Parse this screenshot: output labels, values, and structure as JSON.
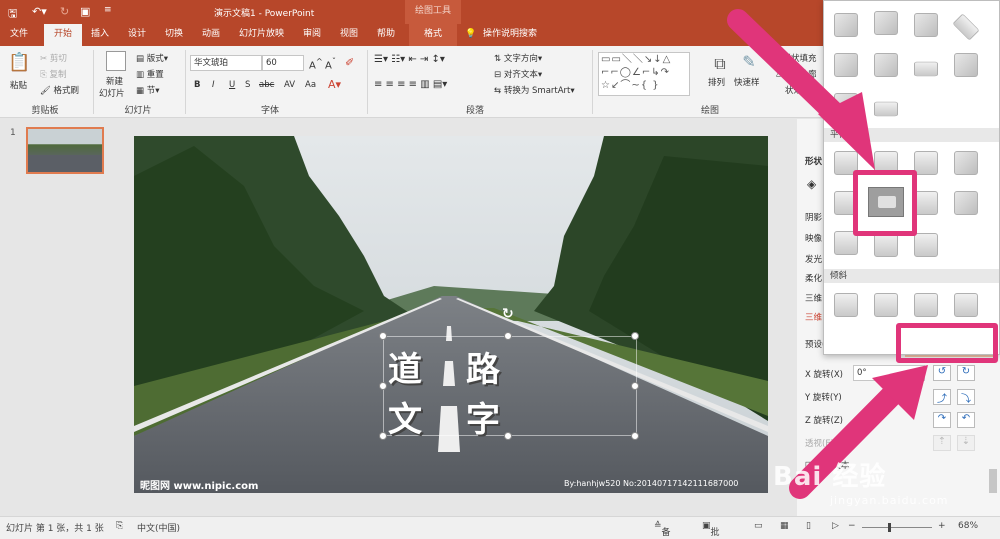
{
  "title_bar": {
    "document_title": "演示文稿1 - PowerPoint",
    "context_tab_group": "绘图工具"
  },
  "tabs": [
    "文件",
    "开始",
    "插入",
    "设计",
    "切换",
    "动画",
    "幻灯片放映",
    "审阅",
    "视图",
    "帮助",
    "格式"
  ],
  "tell_me": "操作说明搜索",
  "ribbon": {
    "clipboard": {
      "paste": "粘贴",
      "cut": "剪切",
      "copy": "复制",
      "format_painter": "格式刷",
      "label": "剪贴板"
    },
    "slides": {
      "new_slide_1": "新建",
      "new_slide_2": "幻灯片",
      "layout": "版式",
      "reset": "重置",
      "section": "节",
      "label": "幻灯片"
    },
    "font": {
      "font_name": "华文琥珀",
      "font_size": "60",
      "bold": "B",
      "italic": "I",
      "underline": "U",
      "strike": "S",
      "shadow": "abc",
      "spacing": "AV",
      "case": "Aa",
      "label": "字体"
    },
    "paragraph": {
      "text_direction": "文字方向",
      "align_text": "对齐文本",
      "smartart": "转换为 SmartArt",
      "label": "段落"
    },
    "drawing": {
      "arrange": "排列",
      "quick_styles": "快速样",
      "shape_fill": "形状填充",
      "shape_outline": "形状轮廓",
      "shape_effects": "状效果",
      "label": "绘图"
    }
  },
  "thumbnail": {
    "number": "1"
  },
  "slide": {
    "line1_char1": "道",
    "line1_char2": "路",
    "line2_char1": "文",
    "line2_char2": "字",
    "watermark_left": "昵图网 www.nipic.com",
    "watermark_right": "By:hanhjw520 No:20140717142111687000"
  },
  "format_pane": {
    "shape_label": "形状",
    "shadow": "阴影",
    "reflection": "映像",
    "glow": "发光",
    "soft_edges": "柔化",
    "bevel3d": "三维",
    "rotation3d": "三维",
    "preset": "预设(P)",
    "x_rotation": "X 旋转(X)",
    "x_value": "0°",
    "y_rotation": "Y 旋转(Y)",
    "z_rotation": "Z 旋转(Z)",
    "perspective": "透视(E)",
    "keep_text_flat": "保持文本",
    "distance": "距"
  },
  "gallery": {
    "header_parallel": "平行",
    "header_oblique": "倾斜"
  },
  "status_bar": {
    "slide_info": "幻灯片 第 1 张，共 1 张",
    "language": "中文(中国)",
    "notes": "备注",
    "comments": "批注",
    "zoom": "68%"
  },
  "watermark": {
    "brand": "Bai 经验",
    "url": "jingyan.baidu.com"
  },
  "colors": {
    "accent": "#b7472a",
    "highlight": "#e0357a",
    "format_tab": "#c75a3c"
  }
}
